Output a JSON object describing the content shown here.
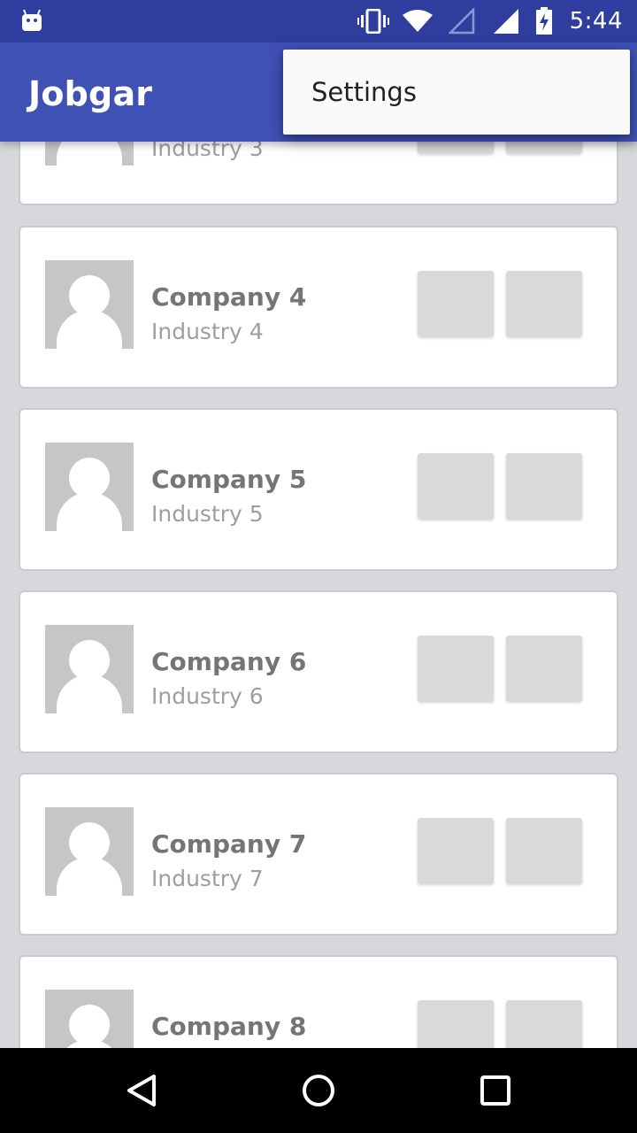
{
  "status_bar": {
    "time": "5:44",
    "icons": [
      "android-icon",
      "vibrate-icon",
      "wifi-icon",
      "signal-empty-icon",
      "signal-full-icon",
      "battery-charging-icon"
    ]
  },
  "app_bar": {
    "title": "Jobgar"
  },
  "overflow_menu": {
    "items": [
      {
        "label": "Settings"
      }
    ]
  },
  "companies": [
    {
      "name": "",
      "industry": "Industry 3"
    },
    {
      "name": "Company 4",
      "industry": "Industry 4"
    },
    {
      "name": "Company 5",
      "industry": "Industry 5"
    },
    {
      "name": "Company 6",
      "industry": "Industry 6"
    },
    {
      "name": "Company 7",
      "industry": "Industry 7"
    },
    {
      "name": "Company 8",
      "industry": ""
    }
  ],
  "colors": {
    "primary": "#3f51b5",
    "primary_dark": "#2f3e9e",
    "background": "#d6d8dc",
    "card": "#ffffff",
    "placeholder": "#d9d9d9"
  },
  "nav_bar": {
    "icons": [
      "back-icon",
      "home-icon",
      "recents-icon"
    ]
  }
}
